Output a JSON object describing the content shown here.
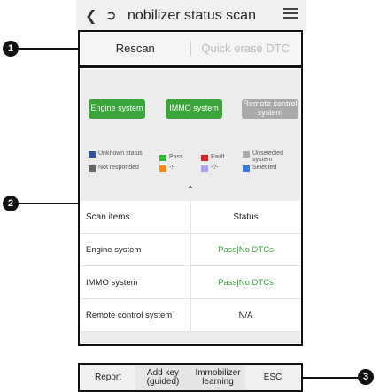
{
  "header": {
    "title": "nobilizer status scan",
    "back_icon": "chevron-left-icon",
    "exit_icon": "exit-icon",
    "menu_icon": "menu-icon"
  },
  "callouts": [
    "1",
    "2",
    "3"
  ],
  "actions": {
    "rescan": "Rescan",
    "quick_erase": "Quick erase DTC"
  },
  "systems": [
    {
      "label": "Engine system",
      "state": "pass",
      "color": "#3aa33a"
    },
    {
      "label": "IMMO system",
      "state": "pass",
      "color": "#3aa33a"
    },
    {
      "label": "Remote control system",
      "state": "unselected",
      "color": "#aaaaaa"
    }
  ],
  "legend": [
    {
      "label": "Unknown status",
      "color": "#2f5597"
    },
    {
      "label": "Pass",
      "color": "#2eb82e"
    },
    {
      "label": "Fault",
      "color": "#e02020"
    },
    {
      "label": "Unselected system",
      "color": "#aaaaaa"
    },
    {
      "label": "Not responded",
      "color": "#666666"
    },
    {
      "label": "-!-",
      "color": "#f28c1e"
    },
    {
      "label": "-?-",
      "color": "#a9a1f0"
    },
    {
      "label": "Selected",
      "color": "#3a78e0"
    }
  ],
  "table": {
    "headers": [
      "Scan items",
      "Status"
    ],
    "rows": [
      {
        "item": "Engine system",
        "status": "Pass|No DTCs"
      },
      {
        "item": "IMMO system",
        "status": "Pass|No DTCs"
      },
      {
        "item": "Remote control system",
        "status": "N/A"
      }
    ]
  },
  "footer": {
    "report": "Report",
    "add_key": "Add key (guided)",
    "immobilizer": "Immobilizer learning",
    "esc": "ESC"
  }
}
